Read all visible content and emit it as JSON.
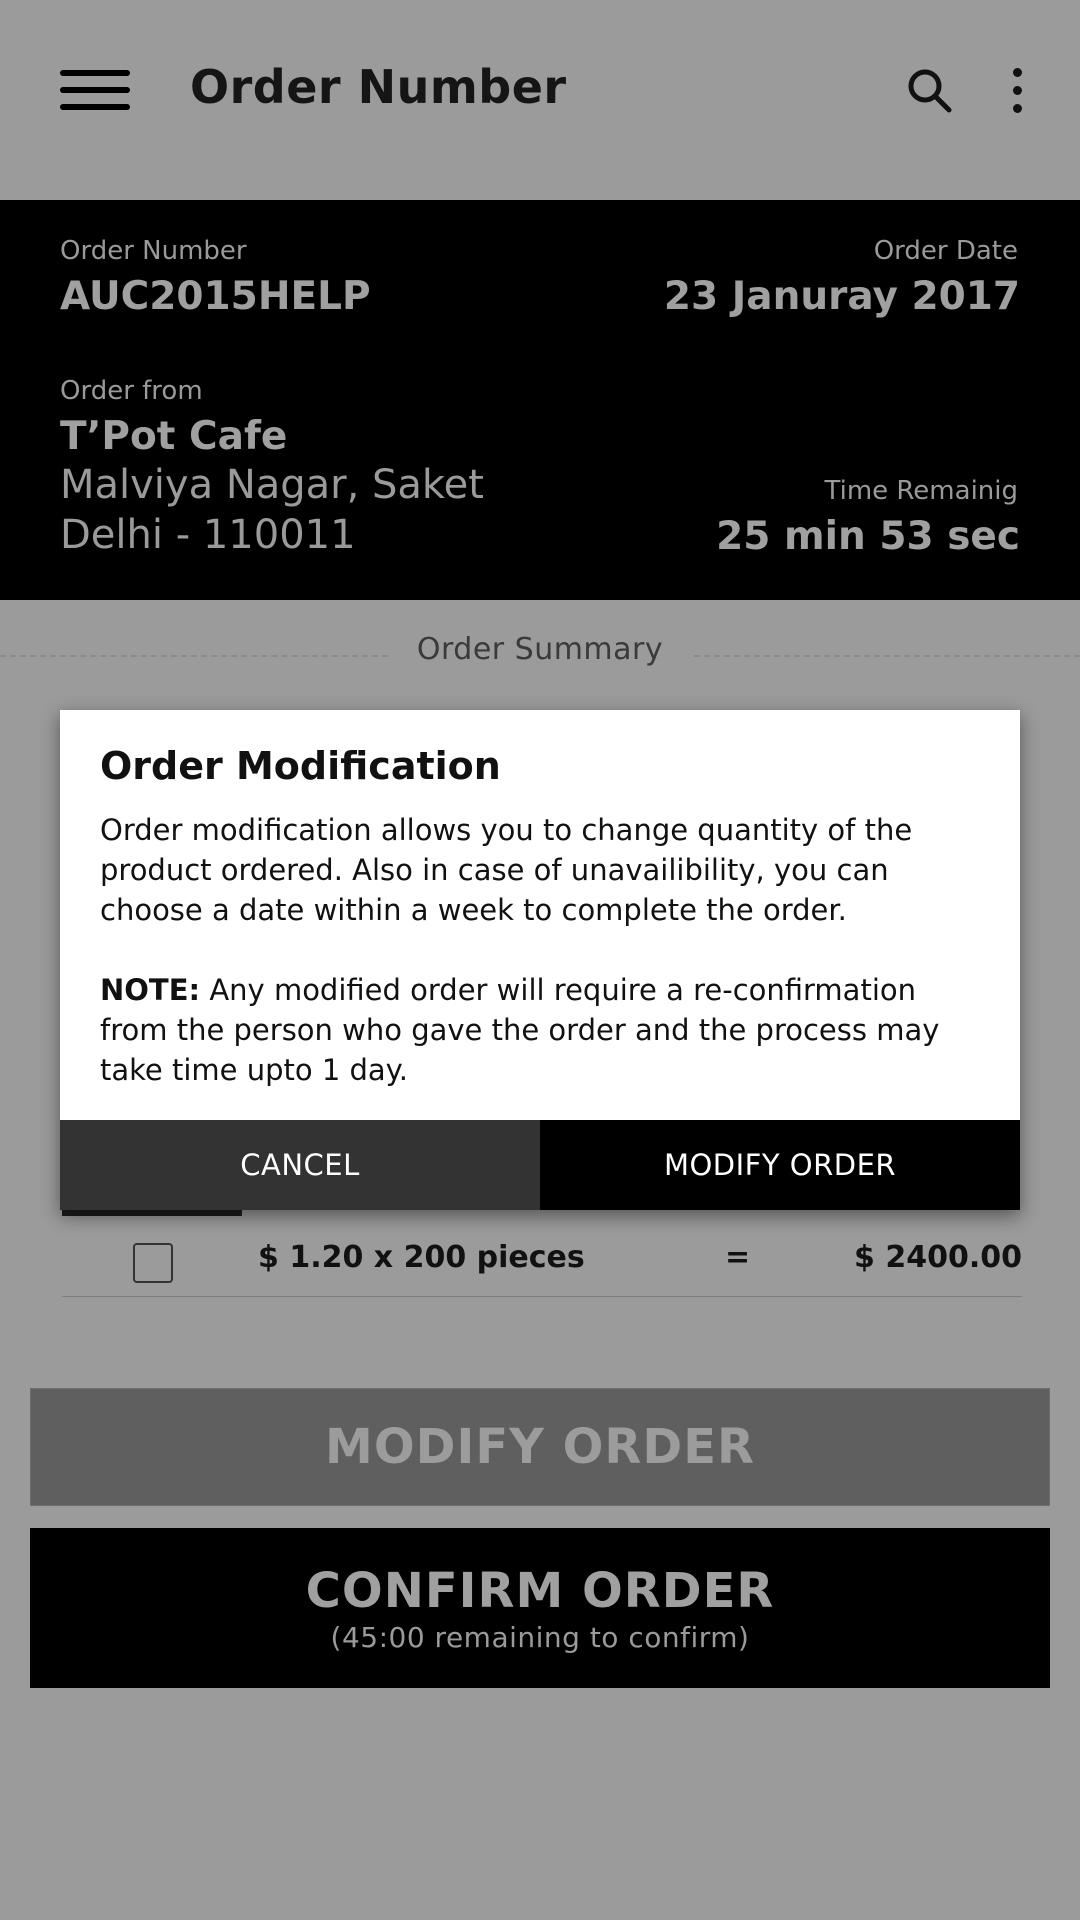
{
  "app_bar": {
    "title": "Order Number",
    "icons": [
      "menu-icon",
      "search-icon",
      "more-vertical-icon"
    ]
  },
  "order": {
    "number_label": "Order Number",
    "number": "AUC2015HELP",
    "date_label": "Order Date",
    "date": "23 Januray 2017",
    "from_label": "Order from",
    "from_name": "T’Pot Cafe",
    "address_line1": "Malviya Nagar, Saket",
    "address_line2": "Delhi - 110011",
    "time_label": "Time Remainig",
    "time_remaining": "25 min 53 sec"
  },
  "summary": {
    "title": "Order Summary",
    "row": {
      "price": "$ 1.20 x 200 pieces",
      "equals": "=",
      "total": "$ 2400.00"
    }
  },
  "actions": {
    "modify_label": "MODIFY ORDER",
    "confirm_label": "CONFIRM ORDER",
    "confirm_sub": "(45:00 remaining to confirm)"
  },
  "dialog": {
    "title": "Order Modification",
    "body": "Order modification allows you to change quantity of the product ordered. Also in case of unavailibility, you can choose a date within a week to complete the order.",
    "note_label": "NOTE:",
    "note_text": " Any modified order will require a re-confirmation from the person who gave the order and the process may take time upto 1 day.",
    "cancel_label": "CANCEL",
    "modify_label": "MODIFY ORDER"
  },
  "colors": {
    "scrim": "#9b9b9b",
    "panel": "#000000",
    "dialog": "#ffffff",
    "cancel_button": "#333333"
  }
}
